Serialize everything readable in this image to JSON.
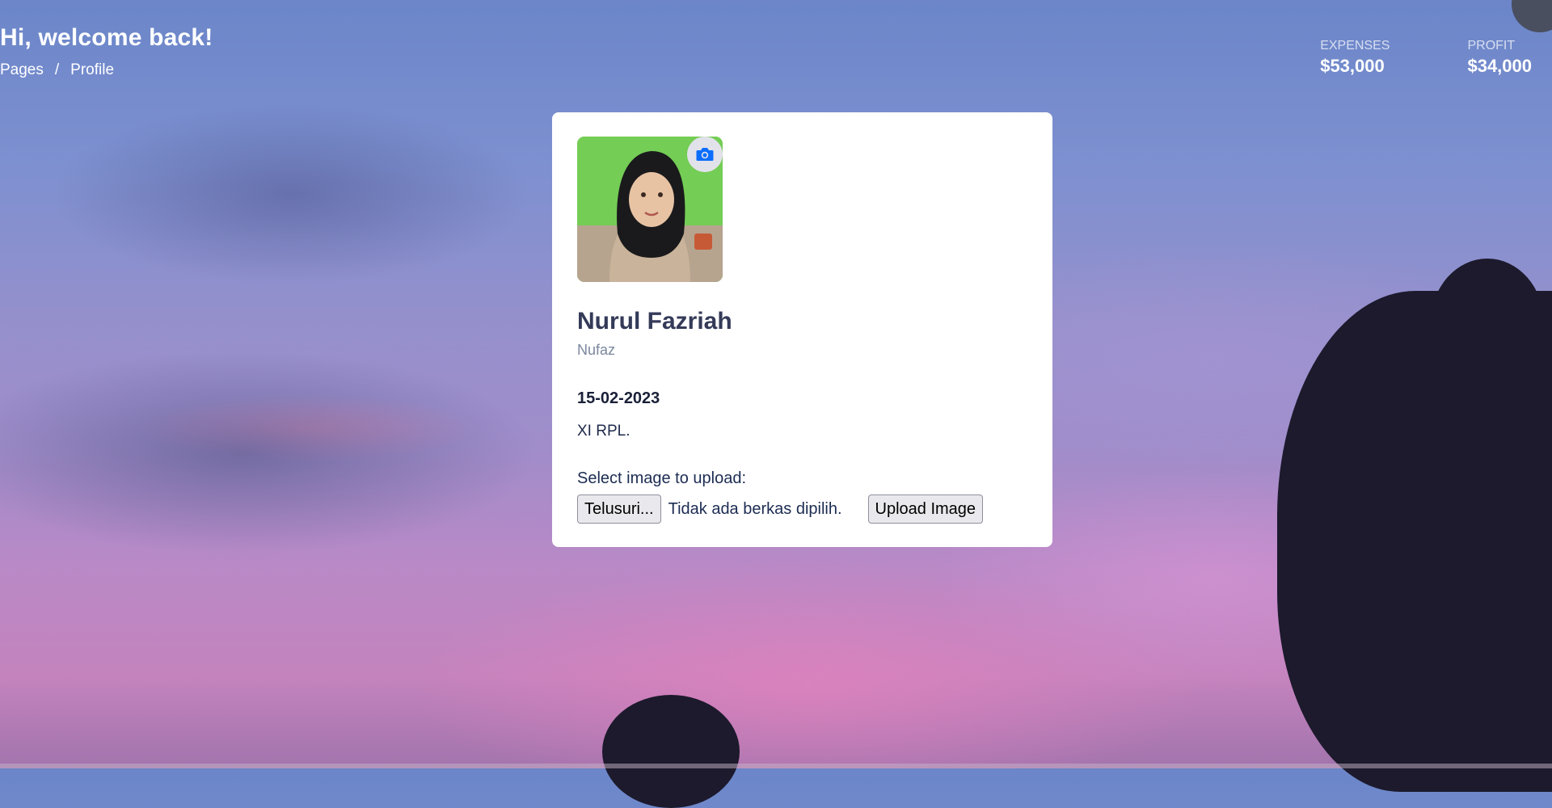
{
  "header": {
    "greeting": "Hi, welcome back!",
    "breadcrumb": [
      {
        "label": "Pages"
      },
      {
        "separator": "/"
      },
      {
        "label": "Profile"
      }
    ]
  },
  "stats": [
    {
      "label": "EXPENSES",
      "value": "$53,000"
    },
    {
      "label": "PROFIT",
      "value": "$34,000"
    }
  ],
  "profile": {
    "name": "Nurul Fazriah",
    "nickname": "Nufaz",
    "date": "15-02-2023",
    "class": "XI RPL.",
    "avatar_icon": "camera-icon"
  },
  "upload": {
    "label": "Select image to upload:",
    "browse_button": "Telusuri...",
    "file_status": "Tidak ada berkas dipilih.",
    "submit_button": "Upload Image"
  },
  "colors": {
    "accent": "#0d6efd",
    "card_bg": "#ffffff",
    "name_color": "#343a58",
    "muted_text": "#7b879e"
  }
}
